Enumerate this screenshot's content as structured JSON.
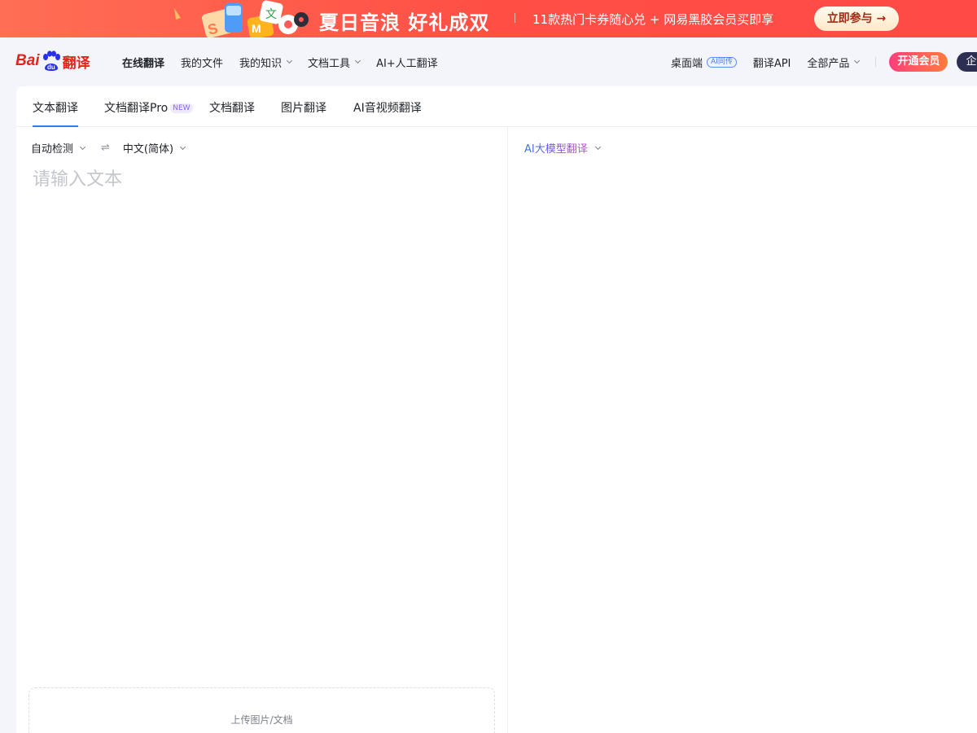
{
  "banner": {
    "title": "夏日音浪  好礼成双",
    "subtitle": "11款热门卡券随心兑 + 网易黑胶会员买即享",
    "button": "立即参与 →"
  },
  "header": {
    "logo": {
      "bai": "Bai",
      "du": "du",
      "fanyi": "翻译"
    },
    "nav": [
      "在线翻译",
      "我的文件",
      "我的知识",
      "文档工具",
      "AI+人工翻译"
    ],
    "right": {
      "desktop": "桌面端",
      "desktop_badge": "AI同传",
      "api": "翻译API",
      "all_products": "全部产品",
      "vip": "开通会员",
      "enterprise": "企"
    }
  },
  "tabs": [
    "文本翻译",
    "文档翻译Pro",
    "文档翻译",
    "图片翻译",
    "AI音视频翻译"
  ],
  "tab_badge": "NEW",
  "source": {
    "from_lang": "自动检测",
    "swap": "⇌",
    "to_lang": "中文(简体)",
    "placeholder": "请输入文本",
    "upload": "上传图片/文档"
  },
  "target": {
    "model": "AI大模型翻译"
  },
  "colors": {
    "banner": "#ff5046",
    "accent": "#2f7bf0",
    "logo_red": "#e1251b",
    "logo_blue": "#2932e1"
  }
}
